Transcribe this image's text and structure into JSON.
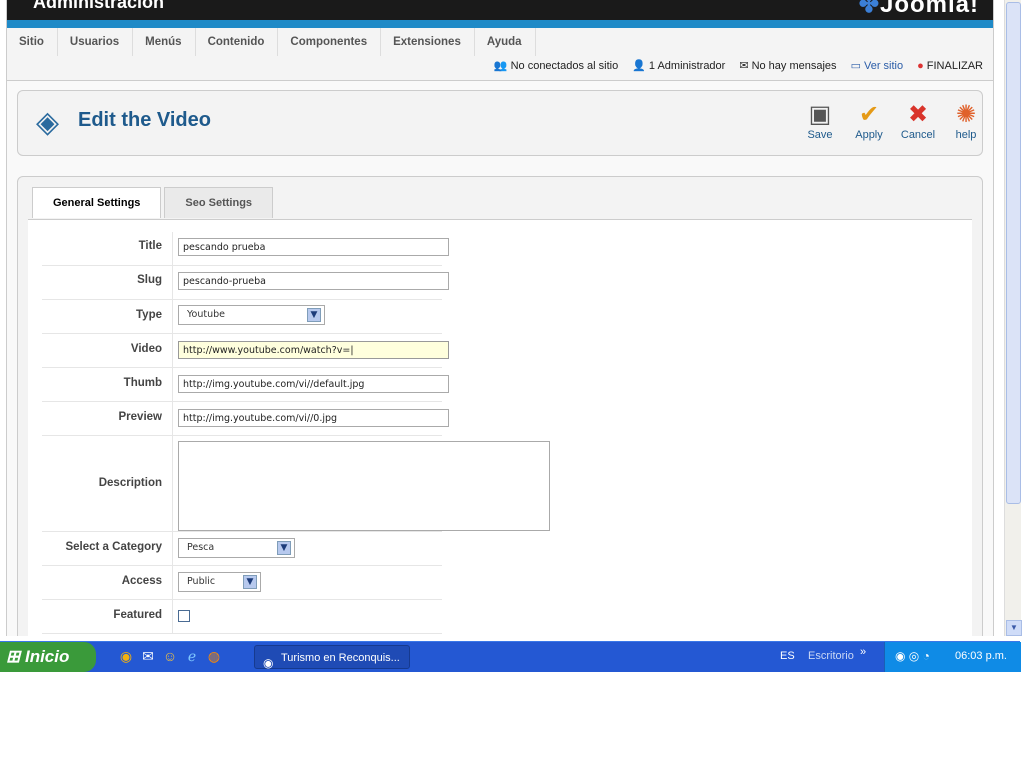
{
  "header": {
    "title": "Administración",
    "logo": "Joomla!"
  },
  "menu": [
    "Sitio",
    "Usuarios",
    "Menús",
    "Contenido",
    "Componentes",
    "Extensiones",
    "Ayuda"
  ],
  "status": {
    "offline": "No conectados al sitio",
    "admins": "1 Administrador",
    "messages": "No hay mensajes",
    "view_site": "Ver sitio",
    "logout": "FINALIZAR"
  },
  "toolbar": {
    "title": "Edit the Video",
    "save": "Save",
    "apply": "Apply",
    "cancel": "Cancel",
    "help": "help"
  },
  "tabs": {
    "general": "General Settings",
    "seo": "Seo Settings"
  },
  "form": {
    "title_label": "Title",
    "title_value": "pescando prueba",
    "slug_label": "Slug",
    "slug_value": "pescando-prueba",
    "type_label": "Type",
    "type_value": "Youtube",
    "video_label": "Video",
    "video_value": "http://www.youtube.com/watch?v=|",
    "thumb_label": "Thumb",
    "thumb_value": "http://img.youtube.com/vi//default.jpg",
    "preview_label": "Preview",
    "preview_value": "http://img.youtube.com/vi//0.jpg",
    "description_label": "Description",
    "description_value": "",
    "category_label": "Select a Category",
    "category_value": "Pesca",
    "access_label": "Access",
    "access_value": "Public",
    "featured_label": "Featured",
    "featured_checked": false
  },
  "taskbar": {
    "start": "Inicio",
    "window": "Turismo en Reconquis...",
    "lang": "ES",
    "desktop": "Escritorio",
    "more": "»",
    "clock": "06:03 p.m."
  },
  "colors": {
    "accent": "#1e5a8c",
    "taskbar": "#2458d3",
    "start": "#3a9a3a"
  }
}
